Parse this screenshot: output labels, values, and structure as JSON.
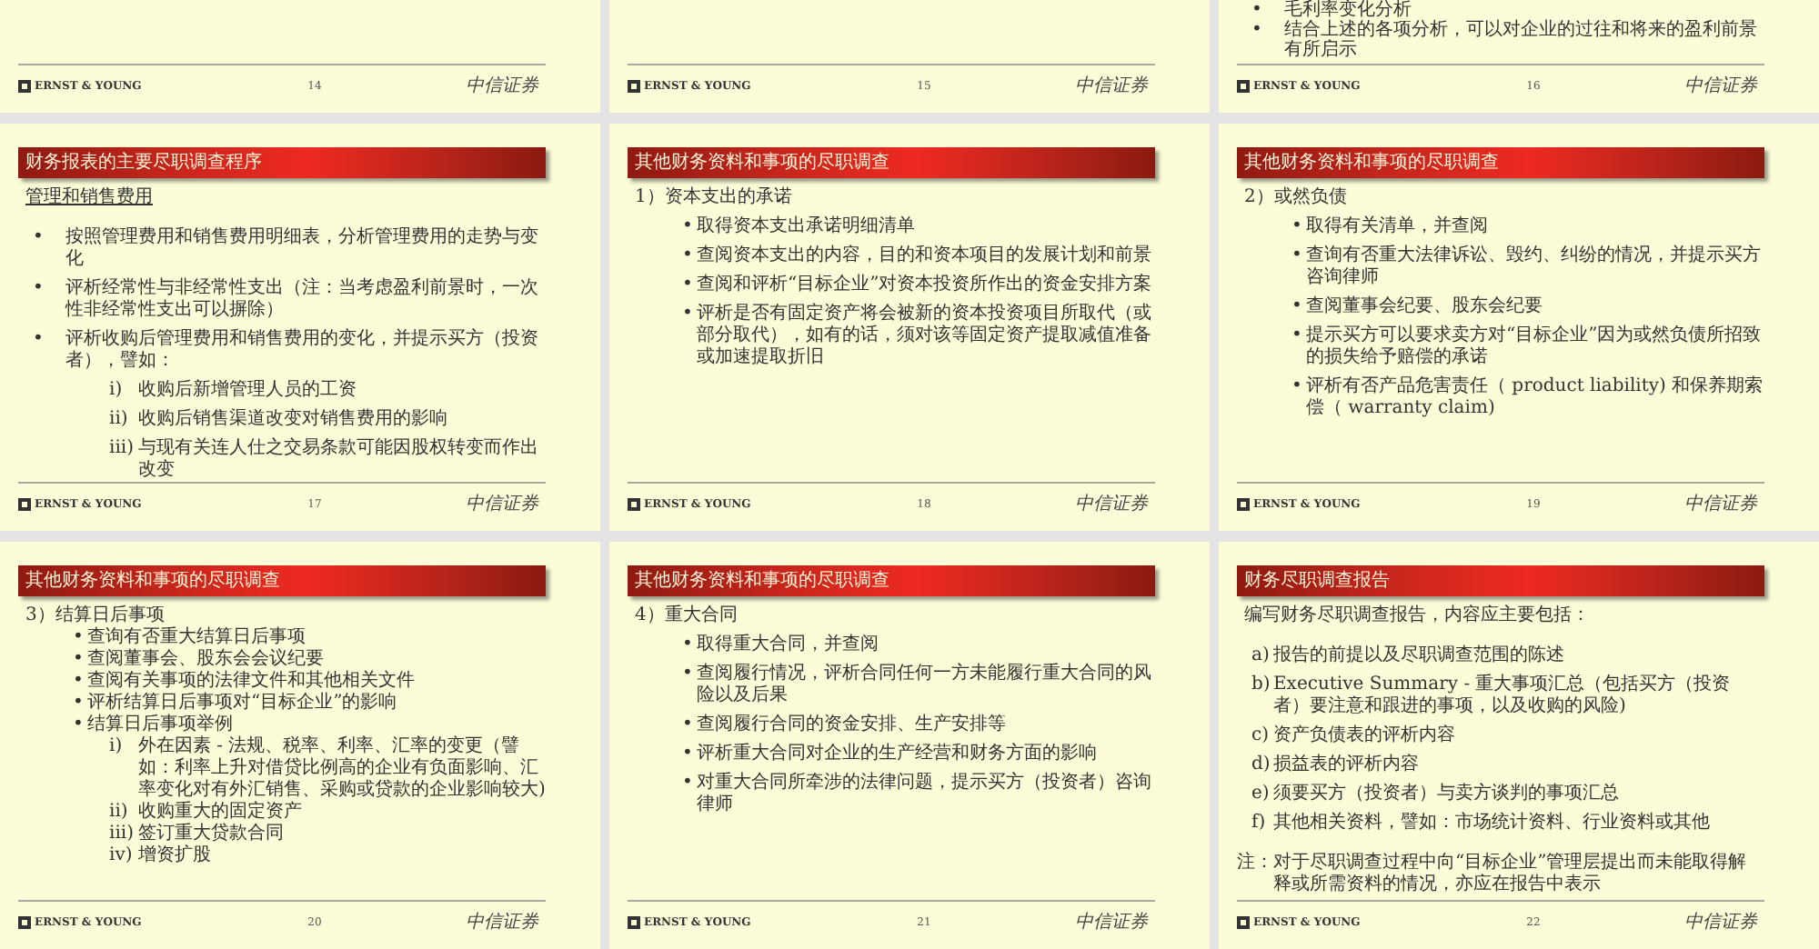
{
  "rows": [
    {
      "slides": [
        {
          "footer": {
            "logo": "ERNST & YOUNG",
            "page": "14",
            "brand": "中信证券"
          }
        },
        {
          "footer": {
            "logo": "ERNST & YOUNG",
            "page": "15",
            "brand": "中信证券"
          }
        },
        {
          "items": [
            {
              "kind": "topbullet",
              "marker": "•",
              "text": "毛利率变化分析"
            },
            {
              "kind": "topbullet",
              "marker": "•",
              "text": "结合上述的各项分析，可以对企业的过往和将来的盈利前景有所启示"
            }
          ],
          "footer": {
            "logo": "ERNST & YOUNG",
            "page": "16",
            "brand": "中信证券"
          }
        }
      ]
    },
    {
      "slides": [
        {
          "title": "财务报表的主要尽职调查程序",
          "items": [
            {
              "kind": "subheading",
              "text": "管理和销售费用"
            },
            {
              "kind": "topbullet",
              "marker": "•",
              "text": "按照管理费用和销售费用明细表，分析管理费用的走势与变化"
            },
            {
              "kind": "topbullet",
              "marker": "•",
              "text": "评析经常性与非经常性支出（注：当考虑盈利前景时，一次性非经常性支出可以摒除）"
            },
            {
              "kind": "topbullet",
              "marker": "•",
              "text": "评析收购后管理费用和销售费用的变化，并提示买方（投资者），譬如："
            },
            {
              "kind": "sub",
              "marker": "i)",
              "text": "收购后新增管理人员的工资"
            },
            {
              "kind": "sub",
              "marker": "ii)",
              "text": "收购后销售渠道改变对销售费用的影响"
            },
            {
              "kind": "sub",
              "marker": "iii)",
              "text": "与现有关连人仕之交易条款可能因股权转变而作出改变"
            }
          ],
          "footer": {
            "logo": "ERNST & YOUNG",
            "page": "17",
            "brand": "中信证券"
          }
        },
        {
          "title": "其他财务资料和事项的尽职调查",
          "items": [
            {
              "kind": "heading",
              "text": "1）资本支出的承诺"
            },
            {
              "kind": "bullet",
              "marker": "•",
              "text": "取得资本支出承诺明细清单"
            },
            {
              "kind": "bullet",
              "marker": "•",
              "text": "查阅资本支出的内容，目的和资本项目的发展计划和前景"
            },
            {
              "kind": "bullet",
              "marker": "•",
              "text": "查阅和评析“目标企业”对资本投资所作出的资金安排方案"
            },
            {
              "kind": "bullet",
              "marker": "•",
              "text": "评析是否有固定资产将会被新的资本投资项目所取代（或部分取代），如有的话，须对该等固定资产提取减值准备或加速提取折旧"
            }
          ],
          "footer": {
            "logo": "ERNST & YOUNG",
            "page": "18",
            "brand": "中信证券"
          }
        },
        {
          "title": "其他财务资料和事项的尽职调查",
          "items": [
            {
              "kind": "heading",
              "text": "2）或然负债"
            },
            {
              "kind": "bullet",
              "marker": "•",
              "text": "取得有关清单，并查阅"
            },
            {
              "kind": "bullet",
              "marker": "•",
              "text": "查询有否重大法律诉讼、毁约、纠纷的情况，并提示买方咨询律师"
            },
            {
              "kind": "bullet",
              "marker": "•",
              "text": "查阅董事会纪要、股东会纪要"
            },
            {
              "kind": "bullet",
              "marker": "•",
              "text": "提示买方可以要求卖方对“目标企业”因为或然负债所招致的损失给予赔偿的承诺"
            },
            {
              "kind": "bullet",
              "marker": "•",
              "text": "评析有否产品危害责任（ product liability) 和保养期索偿（ warranty claim)"
            }
          ],
          "footer": {
            "logo": "ERNST & YOUNG",
            "page": "19",
            "brand": "中信证券"
          }
        }
      ]
    },
    {
      "slides": [
        {
          "title": "其他财务资料和事项的尽职调查",
          "items": [
            {
              "kind": "heading",
              "text": "3）结算日后事项"
            },
            {
              "kind": "bullet",
              "marker": "•",
              "text": "查询有否重大结算日后事项"
            },
            {
              "kind": "bullet",
              "marker": "•",
              "text": "查阅董事会、股东会会议纪要"
            },
            {
              "kind": "bullet",
              "marker": "•",
              "text": "查阅有关事项的法律文件和其他相关文件"
            },
            {
              "kind": "bullet",
              "marker": "•",
              "text": "评析结算日后事项对“目标企业”的影响"
            },
            {
              "kind": "bullet",
              "marker": "•",
              "text": "结算日后事项举例"
            },
            {
              "kind": "sub",
              "marker": "i)",
              "text": "外在因素 - 法规、税率、利率、汇率的变更（譬如：利率上升对借贷比例高的企业有负面影响、汇率变化对有外汇销售、采购或贷款的企业影响较大)"
            },
            {
              "kind": "sub",
              "marker": "ii)",
              "text": "收购重大的固定资产"
            },
            {
              "kind": "sub",
              "marker": "iii)",
              "text": "签订重大贷款合同"
            },
            {
              "kind": "sub",
              "marker": "iv)",
              "text": "增资扩股"
            }
          ],
          "footer": {
            "logo": "ERNST & YOUNG",
            "page": "20",
            "brand": "中信证券"
          }
        },
        {
          "title": "其他财务资料和事项的尽职调查",
          "items": [
            {
              "kind": "heading",
              "text": "4）重大合同"
            },
            {
              "kind": "bullet",
              "marker": "•",
              "text": "取得重大合同，并查阅"
            },
            {
              "kind": "bullet",
              "marker": "•",
              "text": "查阅履行情况，评析合同任何一方未能履行重大合同的风险以及后果"
            },
            {
              "kind": "bullet",
              "marker": "•",
              "text": "查阅履行合同的资金安排、生产安排等"
            },
            {
              "kind": "bullet",
              "marker": "•",
              "text": "评析重大合同对企业的生产经营和财务方面的影响"
            },
            {
              "kind": "bullet",
              "marker": "•",
              "text": "对重大合同所牵涉的法律问题，提示买方（投资者）咨询律师"
            }
          ],
          "footer": {
            "logo": "ERNST & YOUNG",
            "page": "21",
            "brand": "中信证券"
          }
        },
        {
          "title": "财务尽职调查报告",
          "items": [
            {
              "kind": "para",
              "text": "编写财务尽职调查报告，内容应主要包括："
            },
            {
              "kind": "list",
              "marker": "a)",
              "text": "报告的前提以及尽职调查范围的陈述"
            },
            {
              "kind": "list",
              "marker": "b)",
              "text": "Executive Summary - 重大事项汇总（包括买方（投资者）要注意和跟进的事项，以及收购的风险)"
            },
            {
              "kind": "list",
              "marker": "c)",
              "text": "资产负债表的评析内容"
            },
            {
              "kind": "list",
              "marker": "d)",
              "text": "损益表的评析内容"
            },
            {
              "kind": "list",
              "marker": "e)",
              "text": "须要买方（投资者）与卖方谈判的事项汇总"
            },
            {
              "kind": "list",
              "marker": "f)",
              "text": "其他相关资料，譬如：市场统计资料、行业资料或其他"
            },
            {
              "kind": "note",
              "marker": "注：",
              "text": "对于尽职调查过程中向“目标企业”管理层提出而未能取得解释或所需资料的情况，亦应在报告中表示"
            }
          ],
          "footer": {
            "logo": "ERNST & YOUNG",
            "page": "22",
            "brand": "中信证券"
          }
        }
      ]
    }
  ]
}
